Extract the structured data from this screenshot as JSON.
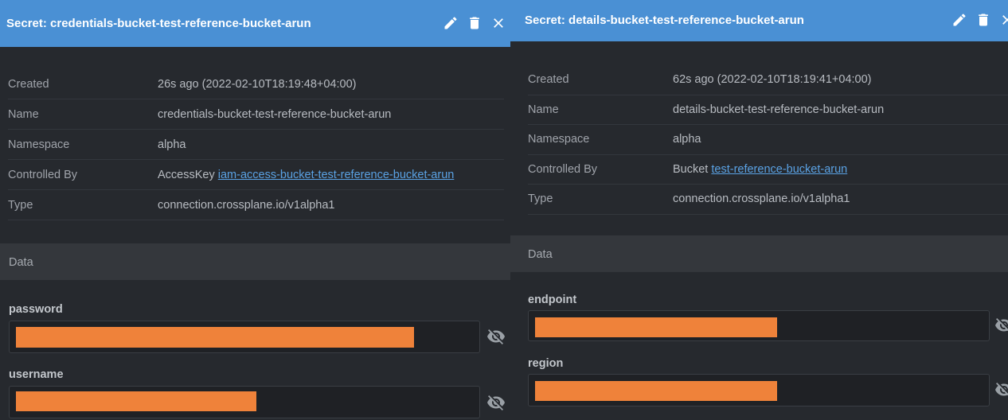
{
  "left_panel": {
    "title": "Secret: credentials-bucket-test-reference-bucket-arun",
    "header_icons": [
      "edit-icon",
      "delete-icon",
      "close-icon"
    ],
    "meta": [
      {
        "key": "Created",
        "value": "26s ago (2022-02-10T18:19:48+04:00)"
      },
      {
        "key": "Name",
        "value": "credentials-bucket-test-reference-bucket-arun"
      },
      {
        "key": "Namespace",
        "value": "alpha"
      },
      {
        "key": "Controlled By",
        "value_prefix": "AccessKey",
        "link": "iam-access-bucket-test-reference-bucket-arun"
      },
      {
        "key": "Type",
        "value": "connection.crossplane.io/v1alpha1"
      }
    ],
    "data_header": "Data",
    "fields": [
      {
        "label": "password"
      },
      {
        "label": "username"
      }
    ]
  },
  "right_panel": {
    "title": "Secret: details-bucket-test-reference-bucket-arun",
    "header_icons": [
      "edit-icon",
      "delete-icon",
      "close-icon"
    ],
    "meta": [
      {
        "key": "Created",
        "value": "62s ago (2022-02-10T18:19:41+04:00)"
      },
      {
        "key": "Name",
        "value": "details-bucket-test-reference-bucket-arun"
      },
      {
        "key": "Namespace",
        "value": "alpha"
      },
      {
        "key": "Controlled By",
        "value_prefix": "Bucket",
        "link": "test-reference-bucket-arun"
      },
      {
        "key": "Type",
        "value": "connection.crossplane.io/v1alpha1"
      }
    ],
    "data_header": "Data",
    "fields": [
      {
        "label": "endpoint"
      },
      {
        "label": "region"
      }
    ]
  },
  "colors": {
    "header_bg": "#4a90d4",
    "link": "#5aa2e4",
    "redaction": "#ef823a"
  }
}
